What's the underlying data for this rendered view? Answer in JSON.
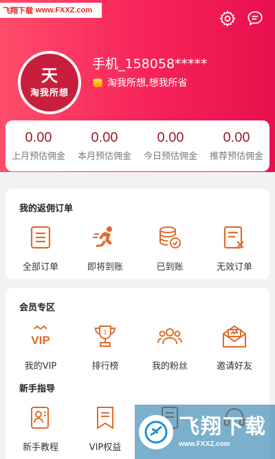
{
  "watermark": {
    "brand": "飞翔下载",
    "url": "www.FXXZ.com",
    "big": "飞翔下载",
    "small_url": "www.FXXZ.com"
  },
  "profile": {
    "username": "手机_158058*****",
    "slogan": "淘我所想,想我所省",
    "logo_char": "天",
    "logo_text": "淘我所想"
  },
  "stats": [
    {
      "value": "0.00",
      "label": "上月预估佣金"
    },
    {
      "value": "0.00",
      "label": "本月预估佣金"
    },
    {
      "value": "0.00",
      "label": "今日预估佣金"
    },
    {
      "value": "0.00",
      "label": "推荐预估佣金"
    }
  ],
  "orders": {
    "title": "我的返佣订单",
    "items": [
      {
        "label": "全部订单",
        "icon": "list-icon"
      },
      {
        "label": "即将到账",
        "icon": "runner-icon"
      },
      {
        "label": "已到账",
        "icon": "coins-check-icon"
      },
      {
        "label": "无效订单",
        "icon": "invalid-doc-icon"
      }
    ]
  },
  "members": {
    "title": "会员专区",
    "items": [
      {
        "label": "我的VIP",
        "icon": "vip-icon"
      },
      {
        "label": "排行榜",
        "icon": "trophy-icon"
      },
      {
        "label": "我的粉丝",
        "icon": "fans-icon"
      },
      {
        "label": "邀请好友",
        "icon": "invite-envelope-icon"
      }
    ]
  },
  "guide": {
    "title": "新手指导",
    "items": [
      {
        "label": "新手教程",
        "icon": "tutorial-icon"
      },
      {
        "label": "VIP权益",
        "icon": "bookmark-icon"
      },
      {
        "label": "",
        "icon": "doc-icon"
      },
      {
        "label": "",
        "icon": "headset-icon"
      }
    ]
  },
  "colors": {
    "header": "#f7225a",
    "accent": "#e06a2a",
    "stat": "#9a1c2c"
  }
}
